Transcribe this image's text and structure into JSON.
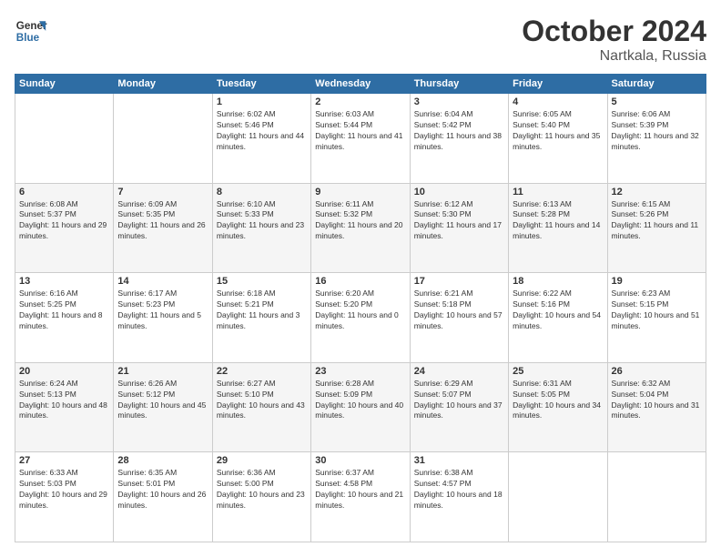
{
  "logo": {
    "line1": "General",
    "line2": "Blue"
  },
  "title": "October 2024",
  "subtitle": "Nartkala, Russia",
  "days_of_week": [
    "Sunday",
    "Monday",
    "Tuesday",
    "Wednesday",
    "Thursday",
    "Friday",
    "Saturday"
  ],
  "weeks": [
    [
      {
        "day": "",
        "info": ""
      },
      {
        "day": "",
        "info": ""
      },
      {
        "day": "1",
        "info": "Sunrise: 6:02 AM\nSunset: 5:46 PM\nDaylight: 11 hours and 44 minutes."
      },
      {
        "day": "2",
        "info": "Sunrise: 6:03 AM\nSunset: 5:44 PM\nDaylight: 11 hours and 41 minutes."
      },
      {
        "day": "3",
        "info": "Sunrise: 6:04 AM\nSunset: 5:42 PM\nDaylight: 11 hours and 38 minutes."
      },
      {
        "day": "4",
        "info": "Sunrise: 6:05 AM\nSunset: 5:40 PM\nDaylight: 11 hours and 35 minutes."
      },
      {
        "day": "5",
        "info": "Sunrise: 6:06 AM\nSunset: 5:39 PM\nDaylight: 11 hours and 32 minutes."
      }
    ],
    [
      {
        "day": "6",
        "info": "Sunrise: 6:08 AM\nSunset: 5:37 PM\nDaylight: 11 hours and 29 minutes."
      },
      {
        "day": "7",
        "info": "Sunrise: 6:09 AM\nSunset: 5:35 PM\nDaylight: 11 hours and 26 minutes."
      },
      {
        "day": "8",
        "info": "Sunrise: 6:10 AM\nSunset: 5:33 PM\nDaylight: 11 hours and 23 minutes."
      },
      {
        "day": "9",
        "info": "Sunrise: 6:11 AM\nSunset: 5:32 PM\nDaylight: 11 hours and 20 minutes."
      },
      {
        "day": "10",
        "info": "Sunrise: 6:12 AM\nSunset: 5:30 PM\nDaylight: 11 hours and 17 minutes."
      },
      {
        "day": "11",
        "info": "Sunrise: 6:13 AM\nSunset: 5:28 PM\nDaylight: 11 hours and 14 minutes."
      },
      {
        "day": "12",
        "info": "Sunrise: 6:15 AM\nSunset: 5:26 PM\nDaylight: 11 hours and 11 minutes."
      }
    ],
    [
      {
        "day": "13",
        "info": "Sunrise: 6:16 AM\nSunset: 5:25 PM\nDaylight: 11 hours and 8 minutes."
      },
      {
        "day": "14",
        "info": "Sunrise: 6:17 AM\nSunset: 5:23 PM\nDaylight: 11 hours and 5 minutes."
      },
      {
        "day": "15",
        "info": "Sunrise: 6:18 AM\nSunset: 5:21 PM\nDaylight: 11 hours and 3 minutes."
      },
      {
        "day": "16",
        "info": "Sunrise: 6:20 AM\nSunset: 5:20 PM\nDaylight: 11 hours and 0 minutes."
      },
      {
        "day": "17",
        "info": "Sunrise: 6:21 AM\nSunset: 5:18 PM\nDaylight: 10 hours and 57 minutes."
      },
      {
        "day": "18",
        "info": "Sunrise: 6:22 AM\nSunset: 5:16 PM\nDaylight: 10 hours and 54 minutes."
      },
      {
        "day": "19",
        "info": "Sunrise: 6:23 AM\nSunset: 5:15 PM\nDaylight: 10 hours and 51 minutes."
      }
    ],
    [
      {
        "day": "20",
        "info": "Sunrise: 6:24 AM\nSunset: 5:13 PM\nDaylight: 10 hours and 48 minutes."
      },
      {
        "day": "21",
        "info": "Sunrise: 6:26 AM\nSunset: 5:12 PM\nDaylight: 10 hours and 45 minutes."
      },
      {
        "day": "22",
        "info": "Sunrise: 6:27 AM\nSunset: 5:10 PM\nDaylight: 10 hours and 43 minutes."
      },
      {
        "day": "23",
        "info": "Sunrise: 6:28 AM\nSunset: 5:09 PM\nDaylight: 10 hours and 40 minutes."
      },
      {
        "day": "24",
        "info": "Sunrise: 6:29 AM\nSunset: 5:07 PM\nDaylight: 10 hours and 37 minutes."
      },
      {
        "day": "25",
        "info": "Sunrise: 6:31 AM\nSunset: 5:05 PM\nDaylight: 10 hours and 34 minutes."
      },
      {
        "day": "26",
        "info": "Sunrise: 6:32 AM\nSunset: 5:04 PM\nDaylight: 10 hours and 31 minutes."
      }
    ],
    [
      {
        "day": "27",
        "info": "Sunrise: 6:33 AM\nSunset: 5:03 PM\nDaylight: 10 hours and 29 minutes."
      },
      {
        "day": "28",
        "info": "Sunrise: 6:35 AM\nSunset: 5:01 PM\nDaylight: 10 hours and 26 minutes."
      },
      {
        "day": "29",
        "info": "Sunrise: 6:36 AM\nSunset: 5:00 PM\nDaylight: 10 hours and 23 minutes."
      },
      {
        "day": "30",
        "info": "Sunrise: 6:37 AM\nSunset: 4:58 PM\nDaylight: 10 hours and 21 minutes."
      },
      {
        "day": "31",
        "info": "Sunrise: 6:38 AM\nSunset: 4:57 PM\nDaylight: 10 hours and 18 minutes."
      },
      {
        "day": "",
        "info": ""
      },
      {
        "day": "",
        "info": ""
      }
    ]
  ]
}
